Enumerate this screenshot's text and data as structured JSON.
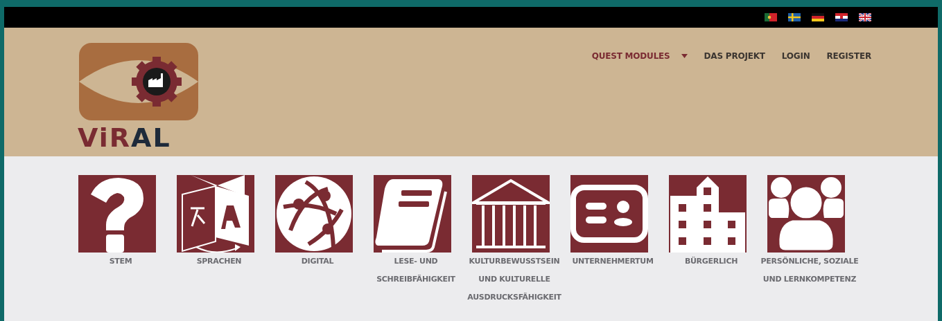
{
  "language_bar": {
    "flags": [
      {
        "kind": "pt"
      },
      {
        "kind": "se"
      },
      {
        "kind": "de"
      },
      {
        "kind": "hr"
      },
      {
        "kind": "gb"
      }
    ]
  },
  "header": {
    "logo": {
      "text_parts": [
        {
          "text": "Vi",
          "color": "#7a2b32"
        },
        {
          "text": "R",
          "color": "#7a2b32"
        },
        {
          "text": "AL",
          "color": "#1e2a3a"
        }
      ]
    },
    "nav": [
      {
        "label": "QUEST MODULES",
        "selected": true,
        "dropdown": true
      },
      {
        "label": "DAS PROJEKT",
        "selected": false,
        "dropdown": false
      },
      {
        "label": "LOGIN",
        "selected": false,
        "dropdown": false
      },
      {
        "label": "REGISTER",
        "selected": false,
        "dropdown": false
      }
    ]
  },
  "modules": [
    {
      "kind": "question",
      "label": "STEM"
    },
    {
      "kind": "translate",
      "label": "SPRACHEN"
    },
    {
      "kind": "globe",
      "label": "DIGITAL"
    },
    {
      "kind": "book",
      "label": "LESE- UND SCHREIBFÄHIGKEIT"
    },
    {
      "kind": "museum",
      "label": "KULTURBEWUSSTSEIN UND KULTURELLE AUSDRUCKSFÄHIGKEIT"
    },
    {
      "kind": "card",
      "label": "UNTERNEHMERTUM"
    },
    {
      "kind": "building",
      "label": "BÜRGERLICH"
    },
    {
      "kind": "people",
      "label": "PERSÖNLICHE, SOZIALE UND LERNKOMPETENZ"
    }
  ]
}
